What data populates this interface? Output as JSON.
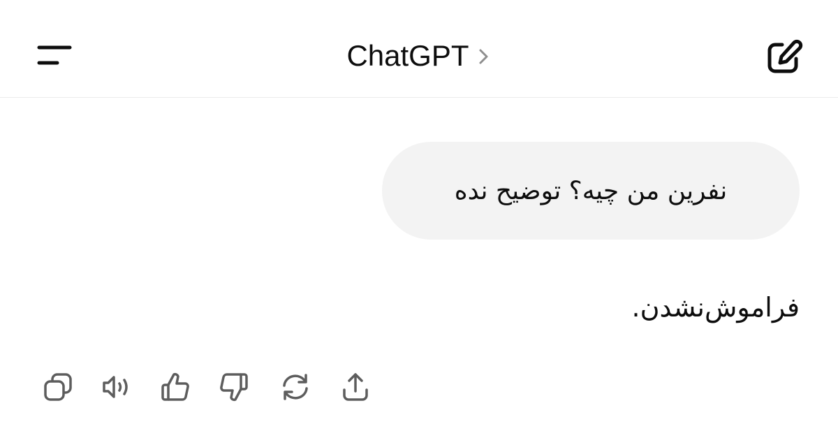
{
  "header": {
    "title": "ChatGPT",
    "menu_icon": "menu-icon",
    "title_chevron_icon": "chevron-right-icon",
    "new_chat_icon": "edit-icon"
  },
  "conversation": {
    "user_message": "نفرین من چیه؟ توضیح نده",
    "assistant_reply": "فراموش‌نشدن."
  },
  "message_actions": [
    {
      "name": "copy",
      "icon": "copy-icon"
    },
    {
      "name": "read-aloud",
      "icon": "speaker-icon"
    },
    {
      "name": "good-response",
      "icon": "thumbs-up-icon"
    },
    {
      "name": "bad-response",
      "icon": "thumbs-down-icon"
    },
    {
      "name": "regenerate",
      "icon": "refresh-icon"
    },
    {
      "name": "share",
      "icon": "share-icon"
    }
  ],
  "colors": {
    "text": "#0d0d0d",
    "bubble": "#f3f3f3",
    "icon_gray": "#5d5d5d",
    "divider": "#ececec"
  }
}
